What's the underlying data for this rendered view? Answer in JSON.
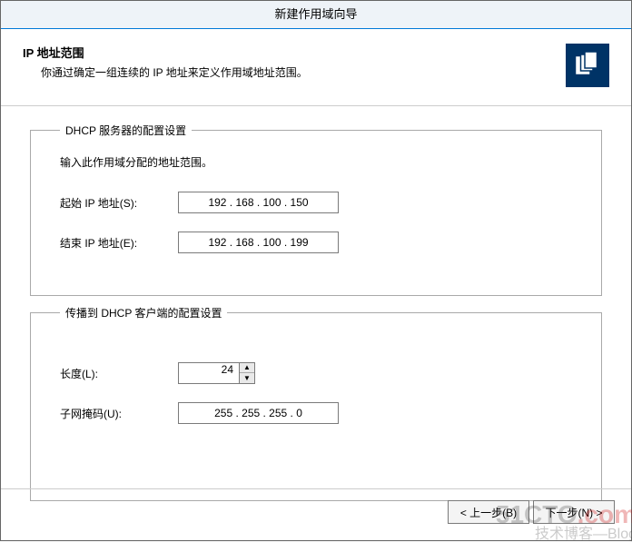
{
  "titlebar": "新建作用域向导",
  "header": {
    "title": "IP 地址范围",
    "desc": "你通过确定一组连续的 IP 地址来定义作用域地址范围。"
  },
  "group1": {
    "legend": "DHCP 服务器的配置设置",
    "instruction": "输入此作用域分配的地址范围。",
    "start_label": "起始 IP 地址(S):",
    "start_ip": "192 . 168 . 100 . 150",
    "end_label": "结束 IP 地址(E):",
    "end_ip": "192 . 168 . 100 . 199"
  },
  "group2": {
    "legend": "传播到 DHCP 客户端的配置设置",
    "length_label": "长度(L):",
    "length_value": "24",
    "mask_label": "子网掩码(U):",
    "mask_value": "255 . 255 . 255 .   0"
  },
  "footer": {
    "back": "< 上一步(B)",
    "next": "下一步(N) >"
  },
  "watermark": {
    "site": "51CTO",
    "dot": ".com",
    "sub": "技术博客—Blog"
  }
}
